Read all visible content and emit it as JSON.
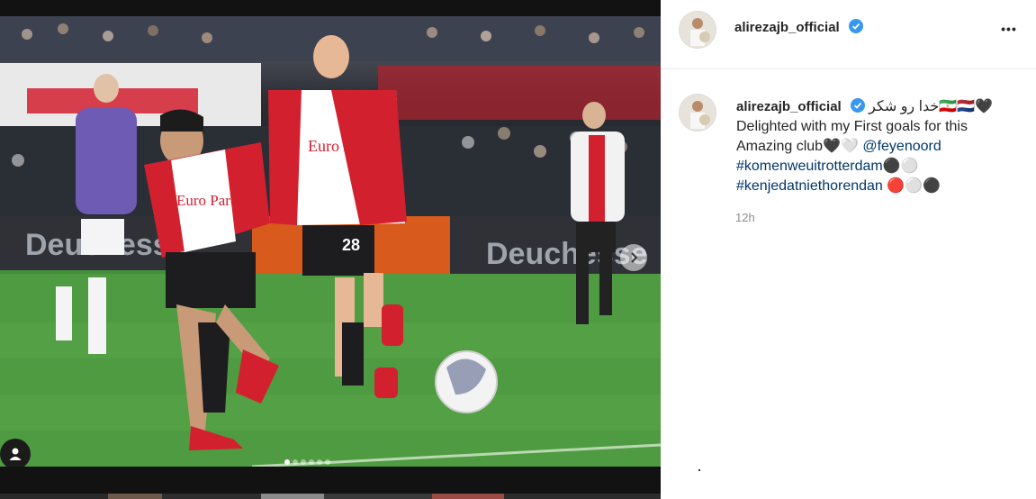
{
  "post": {
    "username": "alirezajb_official",
    "more_label": "•••",
    "caption_arabic": "خدا رو شکر",
    "caption_emoji_after_arabic": "🇮🇷🇳🇱",
    "caption_heart": "🖤",
    "caption_line2": "Delighted with my First goals for this",
    "caption_line3": "Amazing club",
    "caption_line3_emoji": "🖤🤍",
    "mention": "@feyenoord",
    "hashtag1": "#komenweuitrotterdam",
    "hashtag1_emoji": "⚫⚪",
    "hashtag2": "#kenjedatniethorendan",
    "hashtag2_emoji": "🔴⚪⚫",
    "timestamp": "12h"
  },
  "photo": {
    "jersey1_text": "Euro Parcs",
    "jersey2_text": "Euro Parcs",
    "player2_number": "28",
    "board_text": "Deuchesse",
    "carousel_count": 6,
    "carousel_active": 0
  },
  "colors": {
    "verified": "#3897f0",
    "link": "#00376b",
    "feyenoord_red": "#d3202f"
  }
}
